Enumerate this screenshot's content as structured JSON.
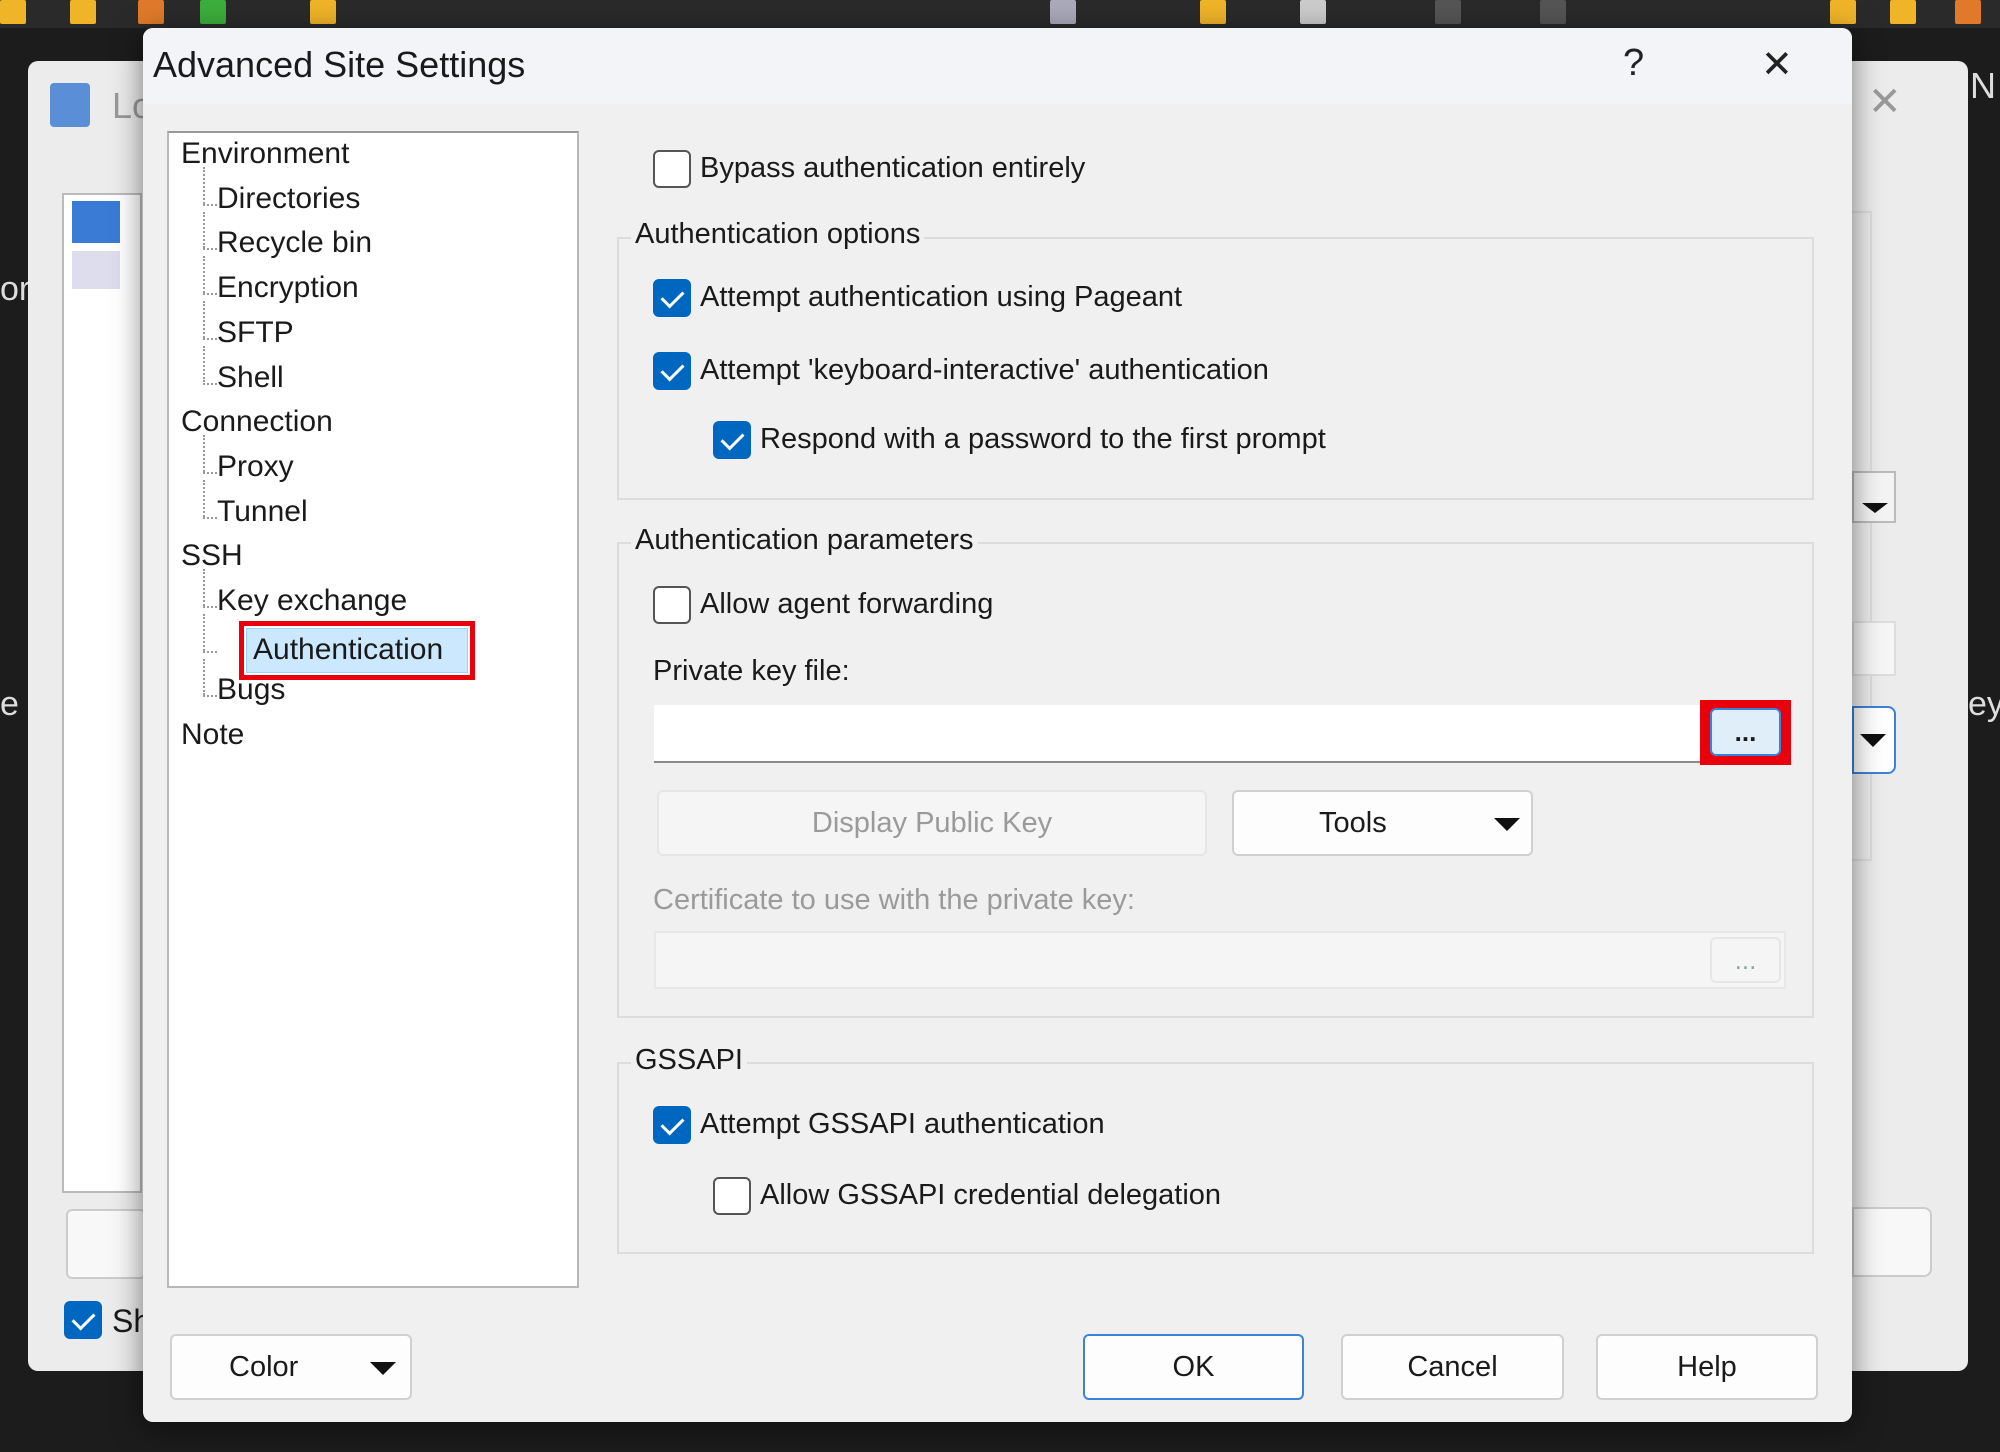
{
  "window": {
    "title": "Advanced Site Settings",
    "help_label": "?",
    "close_label": "✕"
  },
  "background": {
    "left_title": "Lo",
    "left_text1": "or",
    "left_text2": "e H",
    "left_checkbox_label": "Sh",
    "right_text1": "N",
    "right_text2": "ey",
    "close_label": "✕"
  },
  "tree": {
    "items": [
      {
        "label": "Environment",
        "level": 0
      },
      {
        "label": "Directories",
        "level": 1
      },
      {
        "label": "Recycle bin",
        "level": 1
      },
      {
        "label": "Encryption",
        "level": 1
      },
      {
        "label": "SFTP",
        "level": 1
      },
      {
        "label": "Shell",
        "level": 1
      },
      {
        "label": "Connection",
        "level": 0
      },
      {
        "label": "Proxy",
        "level": 1
      },
      {
        "label": "Tunnel",
        "level": 1
      },
      {
        "label": "SSH",
        "level": 0
      },
      {
        "label": "Key exchange",
        "level": 1
      },
      {
        "label": "Authentication",
        "level": 1,
        "selected": true
      },
      {
        "label": "Bugs",
        "level": 1
      },
      {
        "label": "Note",
        "level": 0
      }
    ]
  },
  "auth": {
    "bypass": {
      "label": "Bypass authentication entirely",
      "checked": false
    },
    "options_legend": "Authentication options",
    "pageant": {
      "label": "Attempt authentication using Pageant",
      "checked": true
    },
    "keyboard": {
      "label": "Attempt 'keyboard-interactive' authentication",
      "checked": true
    },
    "respond": {
      "label": "Respond with a password to the first prompt",
      "checked": true
    },
    "params_legend": "Authentication parameters",
    "agent_fwd": {
      "label": "Allow agent forwarding",
      "checked": false
    },
    "private_key_label": "Private key file:",
    "private_key_value": "",
    "browse_label": "...",
    "display_public_key": "Display Public Key",
    "tools": "Tools",
    "cert_label": "Certificate to use with the private key:",
    "cert_value": "",
    "cert_browse_label": "...",
    "gssapi_legend": "GSSAPI",
    "gssapi_attempt": {
      "label": "Attempt GSSAPI authentication",
      "checked": true
    },
    "gssapi_deleg": {
      "label": "Allow GSSAPI credential delegation",
      "checked": false
    }
  },
  "buttons": {
    "color": "Color",
    "ok": "OK",
    "cancel": "Cancel",
    "help": "Help"
  },
  "colors": {
    "accent": "#0067c0",
    "highlight": "#e8000b",
    "selection": "#cce8ff"
  }
}
